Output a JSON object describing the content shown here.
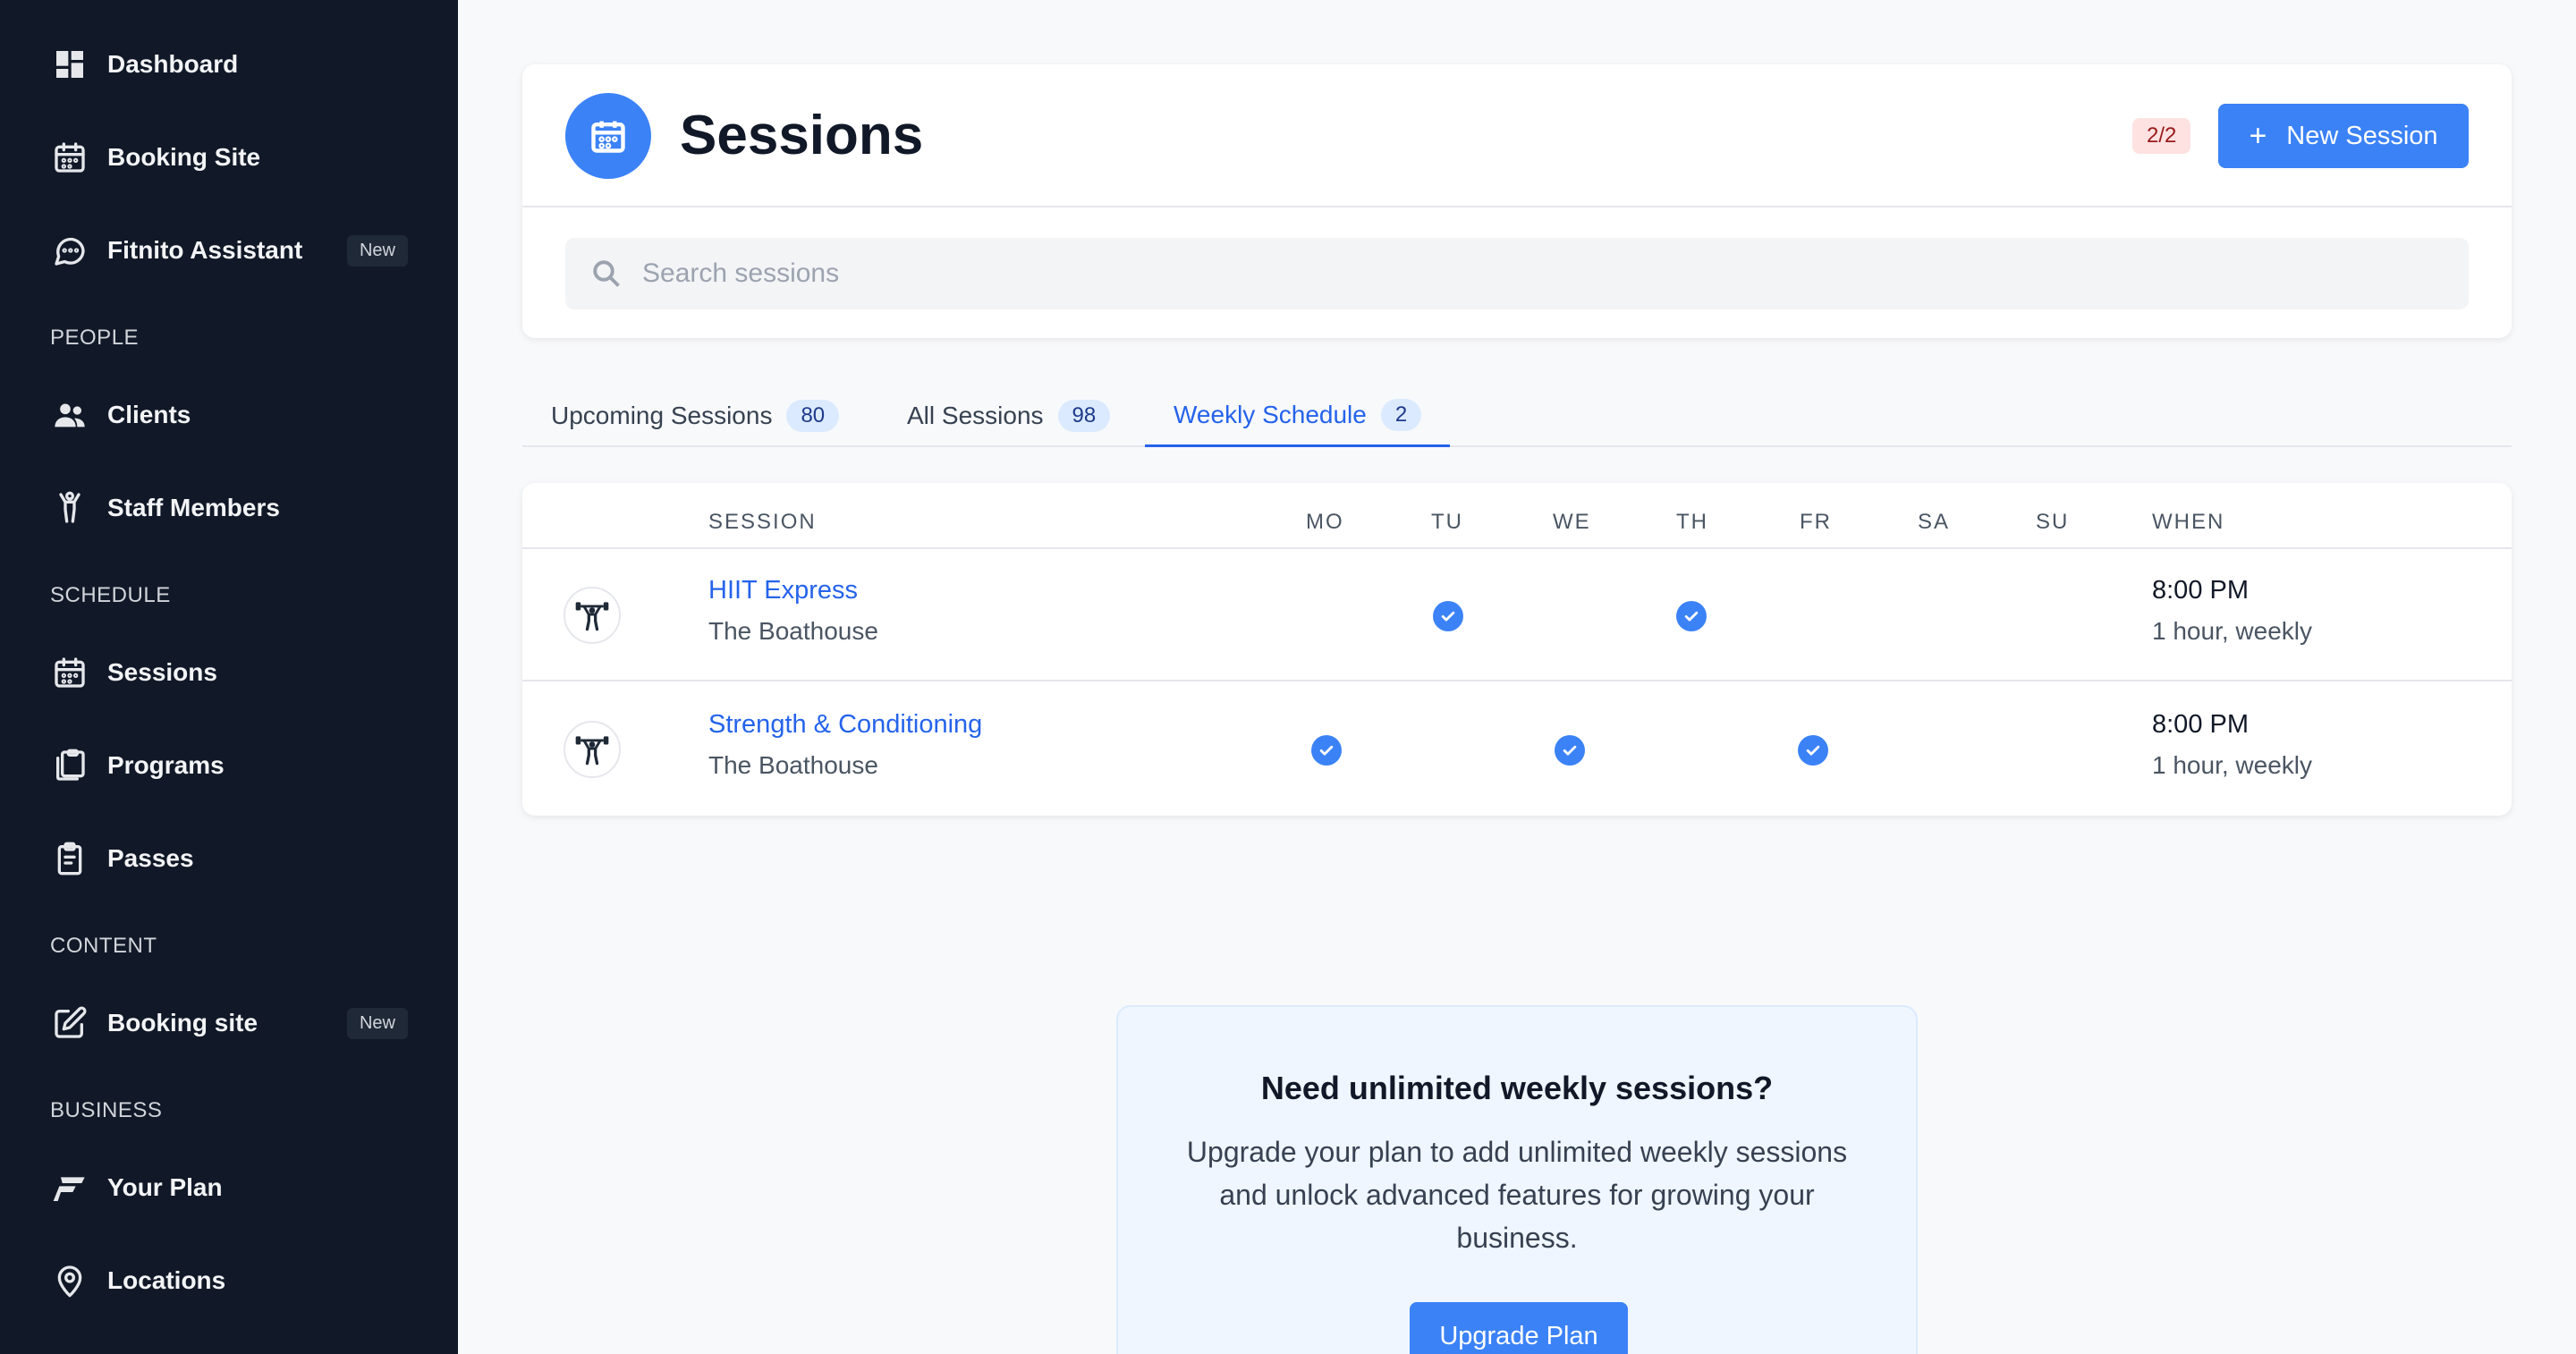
{
  "sidebar": {
    "items": [
      {
        "label": "Dashboard",
        "icon": "dashboard-icon"
      },
      {
        "label": "Booking Site",
        "icon": "calendar-icon"
      },
      {
        "label": "Fitnito Assistant",
        "icon": "chat-icon",
        "badge": "New"
      },
      {
        "label": "Clients",
        "icon": "users-icon"
      },
      {
        "label": "Staff Members",
        "icon": "staff-icon"
      },
      {
        "label": "Sessions",
        "icon": "calendar-icon"
      },
      {
        "label": "Programs",
        "icon": "clipboard-stack-icon"
      },
      {
        "label": "Passes",
        "icon": "clipboard-icon"
      },
      {
        "label": "Booking site",
        "icon": "edit-icon",
        "badge": "New"
      },
      {
        "label": "Your Plan",
        "icon": "fitnito-logo-icon"
      },
      {
        "label": "Locations",
        "icon": "location-pin-icon"
      }
    ],
    "sections": {
      "people": "PEOPLE",
      "schedule": "SCHEDULE",
      "content": "CONTENT",
      "business": "BUSINESS"
    }
  },
  "header": {
    "title": "Sessions",
    "count_badge": "2/2",
    "new_button_plus": "+",
    "new_button_label": "New Session",
    "search_placeholder": "Search sessions"
  },
  "tabs": [
    {
      "label": "Upcoming Sessions",
      "count": "80",
      "active": false
    },
    {
      "label": "All Sessions",
      "count": "98",
      "active": false
    },
    {
      "label": "Weekly Schedule",
      "count": "2",
      "active": true
    }
  ],
  "table": {
    "columns": {
      "session": "SESSION",
      "mo": "MO",
      "tu": "TU",
      "we": "WE",
      "th": "TH",
      "fr": "FR",
      "sa": "SA",
      "su": "SU",
      "when": "WHEN"
    },
    "rows": [
      {
        "name": "HIIT Express",
        "location": "The Boathouse",
        "days": [
          "TU",
          "TH"
        ],
        "time": "8:00 PM",
        "frequency": "1 hour, weekly"
      },
      {
        "name": "Strength & Conditioning",
        "location": "The Boathouse",
        "days": [
          "MO",
          "WE",
          "FR"
        ],
        "time": "8:00 PM",
        "frequency": "1 hour, weekly"
      }
    ]
  },
  "upgrade": {
    "title": "Need unlimited weekly sessions?",
    "text": "Upgrade your plan to add unlimited weekly sessions and unlock advanced features for growing your business.",
    "button": "Upgrade Plan"
  },
  "colors": {
    "sidebar_bg": "#111827",
    "accent": "#3b82f6",
    "link": "#2563eb"
  }
}
